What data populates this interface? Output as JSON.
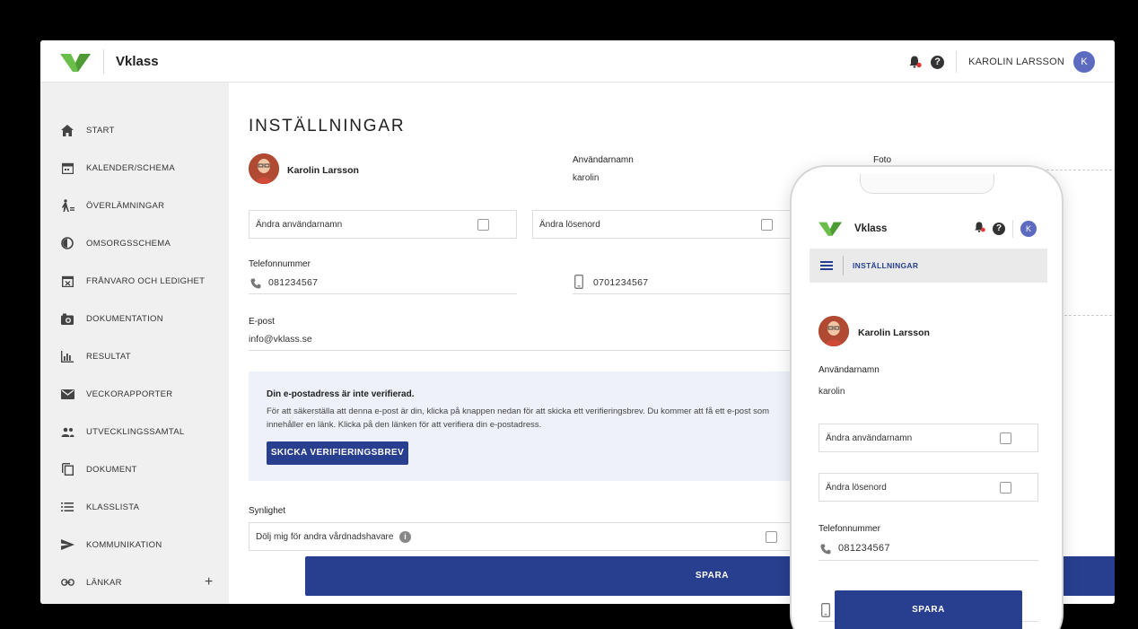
{
  "app": {
    "brand_name": "Vklass",
    "brand_color": "#6abf4b",
    "accent_color": "#283f8f",
    "user_name": "KAROLIN LARSSON",
    "user_initial": "K"
  },
  "sidebar": {
    "items": [
      {
        "label": "START",
        "icon": "home-icon"
      },
      {
        "label": "KALENDER/SCHEMA",
        "icon": "calendar-icon"
      },
      {
        "label": "ÖVERLÄMNINGAR",
        "icon": "handover-icon"
      },
      {
        "label": "OMSORGSSCHEMA",
        "icon": "care-schedule-icon"
      },
      {
        "label": "FRÅNVARO OCH LEDIGHET",
        "icon": "absence-icon"
      },
      {
        "label": "DOKUMENTATION",
        "icon": "camera-icon"
      },
      {
        "label": "RESULTAT",
        "icon": "bar-chart-icon"
      },
      {
        "label": "VECKORAPPORTER",
        "icon": "envelope-icon"
      },
      {
        "label": "UTVECKLINGSSAMTAL",
        "icon": "people-icon"
      },
      {
        "label": "DOKUMENT",
        "icon": "document-icon"
      },
      {
        "label": "KLASSLISTA",
        "icon": "list-icon"
      },
      {
        "label": "KOMMUNIKATION",
        "icon": "send-icon"
      },
      {
        "label": "LÄNKAR",
        "icon": "link-icon",
        "action": "+"
      }
    ]
  },
  "settings": {
    "title": "INSTÄLLNINGAR",
    "profile_name": "Karolin Larsson",
    "username_label": "Användarnamn",
    "username_value": "karolin",
    "photo_label": "Foto",
    "change_username": "Ändra användarnamn",
    "change_password": "Ändra lösenord",
    "phone_label": "Telefonnummer",
    "phone_value": "081234567",
    "mobile_value": "0701234567",
    "email_label": "E-post",
    "email_value": "info@vklass.se",
    "notice_title": "Din e-postadress är inte verifierad.",
    "notice_body": "För att säkerställa att denna e-post är din, klicka på knappen nedan för att skicka ett verifieringsbrev. Du kommer att få ett e-post som innehåller en länk. Klicka på den länken för att verifiera din e-postadress.",
    "verify_button": "SKICKA VERIFIERINGSBREV",
    "visibility_label": "Synlighet",
    "hide_label": "Dölj mig för andra vårdnadshavare",
    "save_button": "SPARA"
  },
  "phone": {
    "brand_name": "Vklass",
    "user_initial": "K",
    "section_title": "INSTÄLLNINGAR",
    "profile_name": "Karolin Larsson",
    "username_label": "Användarnamn",
    "username_value": "karolin",
    "change_username": "Ändra användarnamn",
    "change_password": "Ändra lösenord",
    "phone_label": "Telefonnummer",
    "phone_value": "081234567",
    "save_button": "SPARA"
  }
}
